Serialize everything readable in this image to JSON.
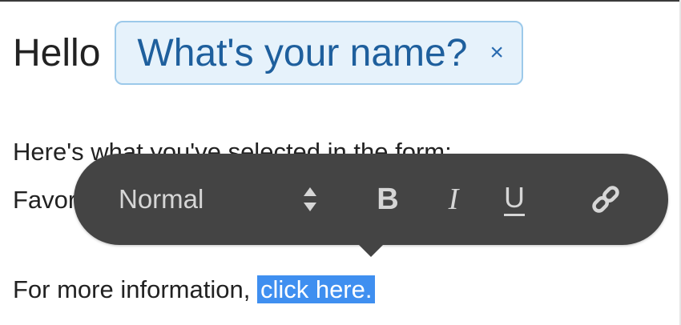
{
  "greeting": {
    "text": "Hello",
    "name_chip": "What's your name?",
    "remove_glyph": "×"
  },
  "content": {
    "line_1": "Here's what you've selected in the form:",
    "line_2": "Favorite",
    "line_3_prefix": "For more information, ",
    "link_text": "click here."
  },
  "toolbar": {
    "format_value": "Normal",
    "bold_label": "B",
    "italic_label": "I",
    "underline_label": "U",
    "icons": [
      "sort-icon",
      "link-icon"
    ]
  },
  "colors": {
    "toolbar_bg": "#444444",
    "toolbar_text": "#d6d6d6",
    "chip_bg": "#e6f2fb",
    "chip_border": "#9cc9ea",
    "chip_text": "#1e5f9d",
    "selection": "#3f8ff0"
  }
}
